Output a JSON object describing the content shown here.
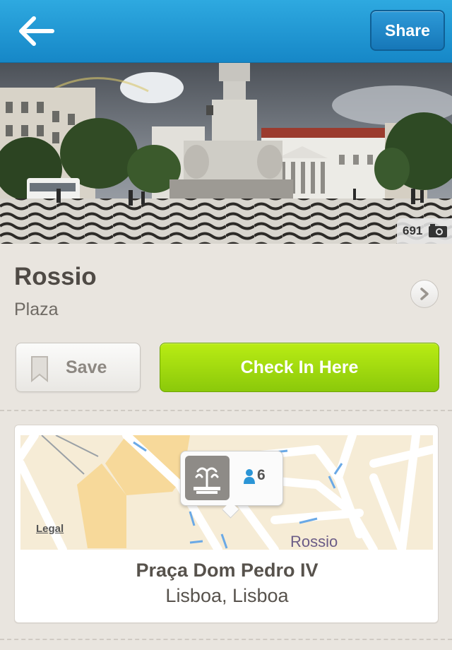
{
  "navbar": {
    "share_label": "Share"
  },
  "hero": {
    "photo_count": "691"
  },
  "venue": {
    "name": "Rossio",
    "category": "Plaza"
  },
  "actions": {
    "save_label": "Save",
    "checkin_label": "Check In Here"
  },
  "map": {
    "legal_label": "Legal",
    "area_label": "Rossio",
    "checkins_count": "6"
  },
  "address": {
    "line1": "Praça Dom Pedro IV",
    "line2": "Lisboa, Lisboa"
  },
  "colors": {
    "nav_blue": "#1b8fcf",
    "checkin_green": "#9ad80f",
    "background": "#e9e5df"
  }
}
